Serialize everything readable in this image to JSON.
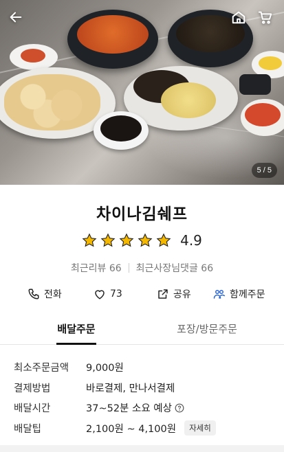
{
  "hero": {
    "page_indicator": "5 / 5",
    "icons": [
      "back-arrow-icon",
      "home-icon",
      "cart-icon"
    ],
    "photo_description_color": "#8d8781"
  },
  "store": {
    "name": "차이나김쉐프",
    "rating": "4.9",
    "stars": 5,
    "star_color": "#f5b800",
    "recent_reviews": "최근리뷰 66",
    "owner_replies": "최근사장님댓글 66"
  },
  "actions": {
    "call_label": "전화",
    "like_count": "73",
    "share_label": "공유",
    "group_order_label": "함께주문",
    "group_order_color": "#2c67d7"
  },
  "tabs": {
    "delivery": "배달주문",
    "pickup": "포장/방문주문"
  },
  "info": {
    "min_order_label": "최소주문금액",
    "min_order_value": "9,000원",
    "payment_label": "결제방법",
    "payment_value": "바로결제, 만나서결제",
    "delivery_time_label": "배달시간",
    "delivery_time_value": "37~52분 소요 예상",
    "delivery_tip_label": "배달팁",
    "delivery_tip_value": "2,100원 ~ 4,100원",
    "detail_button": "자세히"
  }
}
